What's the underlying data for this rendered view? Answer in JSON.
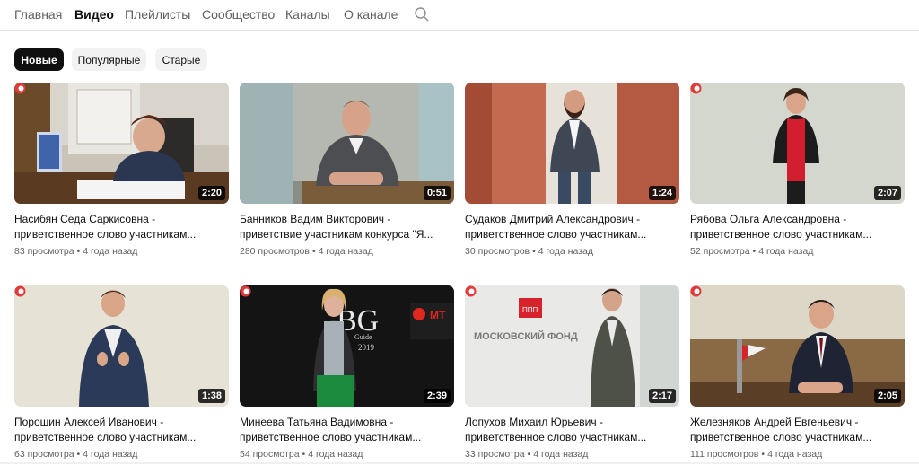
{
  "tabs": [
    {
      "label": "Главная"
    },
    {
      "label": "Видео"
    },
    {
      "label": "Плейлисты"
    },
    {
      "label": "Сообщество"
    },
    {
      "label": "Каналы"
    },
    {
      "label": "О канале"
    }
  ],
  "active_tab": "Видео",
  "icons": {
    "search": "search-icon",
    "brand": "channel-logo-icon"
  },
  "chips": [
    {
      "label": "Новые"
    },
    {
      "label": "Популярные"
    },
    {
      "label": "Старые"
    }
  ],
  "active_chip": "Новые",
  "colors": {
    "accent_dark": "#0f0f0f",
    "muted_text": "#606060",
    "brand": "#e03a3a"
  },
  "videos": [
    {
      "title1": "Насибян Седа Саркисовна -",
      "title2": "приветственное слово участникам...",
      "views": "83 просмотра",
      "age": "4 года назад",
      "duration": "2:20"
    },
    {
      "title1": "Банников Вадим Викторович -",
      "title2": "приветствие участникам конкурса \"Я...",
      "views": "280 просмотров",
      "age": "4 года назад",
      "duration": "0:51"
    },
    {
      "title1": "Судаков Дмитрий Александрович -",
      "title2": "приветственное слово участникам...",
      "views": "30 просмотров",
      "age": "4 года назад",
      "duration": "1:24"
    },
    {
      "title1": "Рябова Ольга Александровна -",
      "title2": "приветственное слово участникам...",
      "views": "52 просмотра",
      "age": "4 года назад",
      "duration": "2:07"
    },
    {
      "title1": "Порошин Алексей Иванович -",
      "title2": "приветственное слово участникам...",
      "views": "63 просмотра",
      "age": "4 года назад",
      "duration": "1:38"
    },
    {
      "title1": "Минеева Татьяна Вадимовна -",
      "title2": "приветственное слово участникам...",
      "views": "54 просмотра",
      "age": "4 года назад",
      "duration": "2:39"
    },
    {
      "title1": "Лопухов Михаил Юрьевич -",
      "title2": "приветственное слово участникам...",
      "views": "33 просмотра",
      "age": "4 года назад",
      "duration": "2:17"
    },
    {
      "title1": "Железняков Андрей Евгеньевич -",
      "title2": "приветственное слово участникам...",
      "views": "111 просмотров",
      "age": "4 года назад",
      "duration": "2:05"
    }
  ],
  "thumb_text": {
    "bg_logo": "BG",
    "bg_year": "2019",
    "bg_sub": "Guide",
    "fund_name": "МОСКОВСКИЙ ФОНД",
    "fund_logo": "ППП",
    "mt": "МТ"
  }
}
